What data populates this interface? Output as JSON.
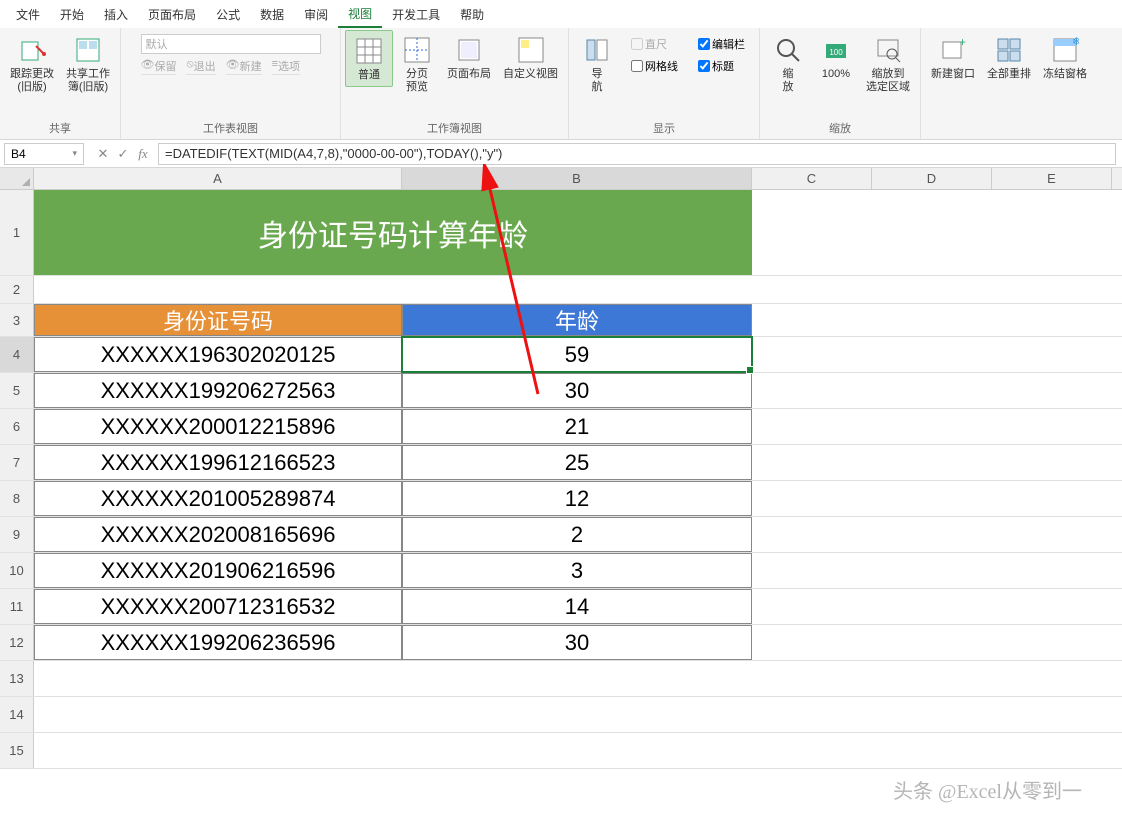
{
  "menu": {
    "items": [
      "文件",
      "开始",
      "插入",
      "页面布局",
      "公式",
      "数据",
      "审阅",
      "视图",
      "开发工具",
      "帮助"
    ],
    "active": 7
  },
  "ribbon": {
    "share": {
      "label": "共享",
      "track": "跟踪更改\n(旧版)",
      "shareWb": "共享工作\n簿(旧版)"
    },
    "wsview": {
      "label": "工作表视图",
      "default_placeholder": "默认",
      "keep": "保留",
      "exit": "退出",
      "new": "新建",
      "options": "选项"
    },
    "wbview": {
      "label": "工作簿视图",
      "normal": "普通",
      "pagebreak": "分页\n预览",
      "pagelayout": "页面布局",
      "custom": "自定义视图"
    },
    "nav": {
      "label": "导航",
      "navbtn": "导\n航"
    },
    "show": {
      "label": "显示",
      "ruler": "直尺",
      "formulabar": "编辑栏",
      "gridlines": "网格线",
      "headings": "标题"
    },
    "zoom": {
      "label": "缩放",
      "zoom": "缩\n放",
      "pct": "100%",
      "tosel": "缩放到\n选定区域"
    },
    "window": {
      "newwin": "新建窗口",
      "arrange": "全部重排",
      "freeze": "冻结窗格"
    }
  },
  "namebox": "B4",
  "formula": "=DATEDIF(TEXT(MID(A4,7,8),\"0000-00-00\"),TODAY(),\"y\")",
  "cols": [
    "A",
    "B",
    "C",
    "D",
    "E"
  ],
  "sheet": {
    "title": "身份证号码计算年龄",
    "hdr_id": "身份证号码",
    "hdr_age": "年龄",
    "rows": [
      {
        "id": "XXXXXX196302020125",
        "age": "59"
      },
      {
        "id": "XXXXXX199206272563",
        "age": "30"
      },
      {
        "id": "XXXXXX200012215896",
        "age": "21"
      },
      {
        "id": "XXXXXX199612166523",
        "age": "25"
      },
      {
        "id": "XXXXXX201005289874",
        "age": "12"
      },
      {
        "id": "XXXXXX202008165696",
        "age": "2"
      },
      {
        "id": "XXXXXX201906216596",
        "age": "3"
      },
      {
        "id": "XXXXXX200712316532",
        "age": "14"
      },
      {
        "id": "XXXXXX199206236596",
        "age": "30"
      }
    ]
  },
  "watermark": "头条 @Excel从零到一"
}
